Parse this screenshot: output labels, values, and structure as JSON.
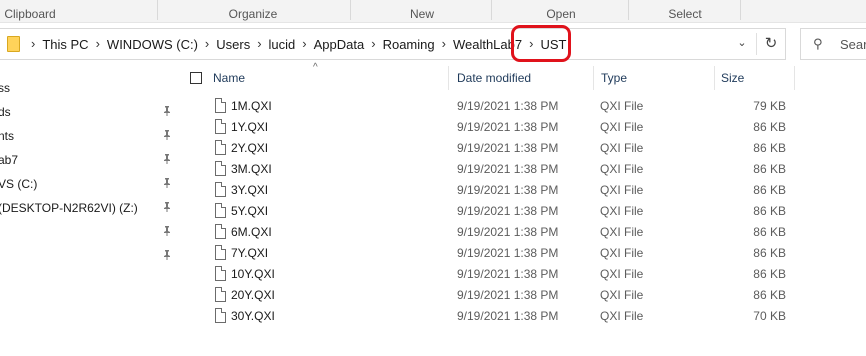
{
  "ribbon": {
    "groups": [
      "Clipboard",
      "Organize",
      "New",
      "Open",
      "Select"
    ]
  },
  "address": {
    "crumbs": [
      "This PC",
      "WINDOWS (C:)",
      "Users",
      "lucid",
      "AppData",
      "Roaming",
      "WealthLab7",
      "UST"
    ],
    "separator": "›",
    "dropdown_glyph": "⌄",
    "refresh_glyph": "↻"
  },
  "search": {
    "placeholder": "Searc",
    "icon_glyph": "⚲"
  },
  "sidebar": {
    "items": [
      {
        "label": "ss",
        "pinned": false
      },
      {
        "label": "ds",
        "pinned": true
      },
      {
        "label": "nts",
        "pinned": true
      },
      {
        "label": "ab7",
        "pinned": true
      },
      {
        "label": "VS (C:)",
        "pinned": true
      },
      {
        "label": "(DESKTOP-N2R62VI) (Z:)",
        "pinned": true
      },
      {
        "label": "",
        "pinned": true
      },
      {
        "label": "",
        "pinned": true
      }
    ]
  },
  "columns": {
    "name": "Name",
    "date": "Date modified",
    "type": "Type",
    "size": "Size",
    "sort_glyph": "^"
  },
  "files": [
    {
      "name": "1M.QXI",
      "date": "9/19/2021 1:38 PM",
      "type": "QXI File",
      "size": "79 KB"
    },
    {
      "name": "1Y.QXI",
      "date": "9/19/2021 1:38 PM",
      "type": "QXI File",
      "size": "86 KB"
    },
    {
      "name": "2Y.QXI",
      "date": "9/19/2021 1:38 PM",
      "type": "QXI File",
      "size": "86 KB"
    },
    {
      "name": "3M.QXI",
      "date": "9/19/2021 1:38 PM",
      "type": "QXI File",
      "size": "86 KB"
    },
    {
      "name": "3Y.QXI",
      "date": "9/19/2021 1:38 PM",
      "type": "QXI File",
      "size": "86 KB"
    },
    {
      "name": "5Y.QXI",
      "date": "9/19/2021 1:38 PM",
      "type": "QXI File",
      "size": "86 KB"
    },
    {
      "name": "6M.QXI",
      "date": "9/19/2021 1:38 PM",
      "type": "QXI File",
      "size": "86 KB"
    },
    {
      "name": "7Y.QXI",
      "date": "9/19/2021 1:38 PM",
      "type": "QXI File",
      "size": "86 KB"
    },
    {
      "name": "10Y.QXI",
      "date": "9/19/2021 1:38 PM",
      "type": "QXI File",
      "size": "86 KB"
    },
    {
      "name": "20Y.QXI",
      "date": "9/19/2021 1:38 PM",
      "type": "QXI File",
      "size": "86 KB"
    },
    {
      "name": "30Y.QXI",
      "date": "9/19/2021 1:38 PM",
      "type": "QXI File",
      "size": "70 KB"
    }
  ],
  "colors": {
    "highlight": "#e0121b",
    "folder": "#ffd35a",
    "header_text": "#1f3a5a"
  }
}
